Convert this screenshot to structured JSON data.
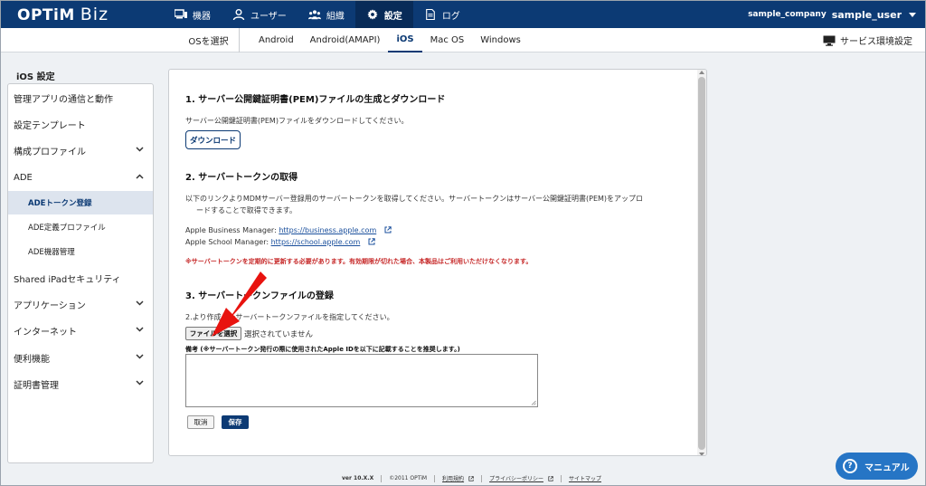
{
  "header": {
    "logo_brand": "OPTiM",
    "logo_product": "Biz",
    "nav": [
      {
        "label": "機器",
        "icon": "device-icon"
      },
      {
        "label": "ユーザー",
        "icon": "user-icon"
      },
      {
        "label": "組織",
        "icon": "organization-icon"
      },
      {
        "label": "設定",
        "icon": "gear-icon",
        "active": true
      },
      {
        "label": "ログ",
        "icon": "log-icon"
      }
    ],
    "company": "sample_company",
    "username": "sample_user"
  },
  "subnav": {
    "os_select_label": "OSを選択",
    "tabs": [
      "Android",
      "Android(AMAPI)",
      "iOS",
      "Mac OS",
      "Windows"
    ],
    "active_tab": "iOS",
    "service_env_label": "サービス環境設定"
  },
  "sidebar": {
    "title": "iOS 設定",
    "items": [
      {
        "label": "管理アプリの通信と動作"
      },
      {
        "label": "設定テンプレート"
      },
      {
        "label": "構成プロファイル",
        "chevron": "down"
      },
      {
        "label": "ADE",
        "chevron": "up"
      },
      {
        "label": "ADEトークン登録",
        "sub": true,
        "active": true
      },
      {
        "label": "ADE定義プロファイル",
        "sub": true
      },
      {
        "label": "ADE機器管理",
        "sub": true
      },
      {
        "label": "Shared iPadセキュリティ"
      },
      {
        "label": "アプリケーション",
        "chevron": "down"
      },
      {
        "label": "インターネット",
        "chevron": "down"
      },
      {
        "label": "便利機能",
        "chevron": "down"
      },
      {
        "label": "証明書管理",
        "chevron": "down"
      }
    ]
  },
  "main": {
    "section1": {
      "title": "1. サーバー公開鍵証明書(PEM)ファイルの生成とダウンロード",
      "description": "サーバー公開鍵証明書(PEM)ファイルをダウンロードしてください。",
      "download_button": "ダウンロード"
    },
    "section2": {
      "title": "2. サーバートークンの取得",
      "description_line1": "以下のリンクよりMDMサーバー登録用のサーバートークンを取得してください。サーバートークンはサーバー公開鍵証明書(PEM)をアップロ",
      "description_line2": "ードすることで取得できます。",
      "abm_label": "Apple Business Manager: ",
      "abm_link": "https://business.apple.com",
      "asm_label": "Apple School Manager: ",
      "asm_link": "https://school.apple.com",
      "warning": "※サーバートークンを定期的に更新する必要があります。有効期限が切れた場合、本製品はご利用いただけなくなります。"
    },
    "section3": {
      "title": "3. サーバートークンファイルの登録",
      "description": "2.より作成したサーバートークンファイルを指定してください。",
      "file_button": "ファイルを選択",
      "file_status": "選択されていません",
      "note_label": "備考 (※サーバートークン発行の際に使用されたApple IDを以下に記載することを推奨します。)",
      "note_value": "",
      "cancel_button": "取消",
      "save_button": "保存"
    }
  },
  "footer": {
    "version": "ver 10.X.X",
    "copyright": "©2011 OPTiM",
    "links": [
      "利用規約",
      "プライバシーポリシー",
      "サイトマップ"
    ]
  },
  "manual_button": "マニュアル",
  "colors": {
    "brand_navy": "#0c3a74",
    "warning_red": "#c62828",
    "manual_blue": "#2675c5",
    "arrow_red": "#e8130f"
  }
}
